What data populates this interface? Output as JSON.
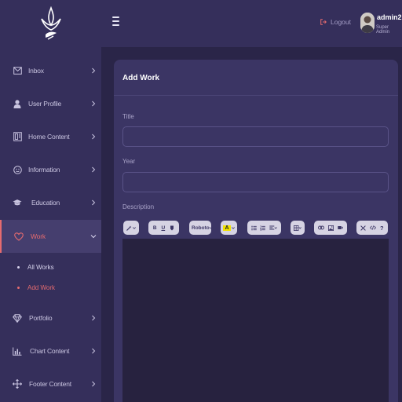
{
  "header": {
    "logout_label": "Logout",
    "user_name": "admin2",
    "user_role": "Super Admin"
  },
  "sidebar": {
    "items": [
      {
        "label": "Inbox",
        "icon": "inbox-icon"
      },
      {
        "label": "User Profile",
        "icon": "user-icon"
      },
      {
        "label": "Home Content",
        "icon": "home-content-icon"
      },
      {
        "label": "Information",
        "icon": "info-icon"
      },
      {
        "label": "Education",
        "icon": "graduation-cap-icon"
      },
      {
        "label": "Work",
        "icon": "heart-icon"
      },
      {
        "label": "Portfolio",
        "icon": "diamond-icon"
      },
      {
        "label": "Chart Content",
        "icon": "chart-icon"
      },
      {
        "label": "Footer Content",
        "icon": "move-icon"
      }
    ],
    "work_sub": [
      {
        "label": "All Works"
      },
      {
        "label": "Add Work"
      }
    ]
  },
  "form": {
    "title": "Add Work",
    "fields": {
      "title_label": "Title",
      "year_label": "Year",
      "description_label": "Description"
    },
    "toolbar": {
      "font_name": "Roboto"
    }
  },
  "colors": {
    "accent": "#e56b6f",
    "sidebar_bg": "#352f5b",
    "page_bg": "#2a2548",
    "card_bg": "#3b3564"
  }
}
